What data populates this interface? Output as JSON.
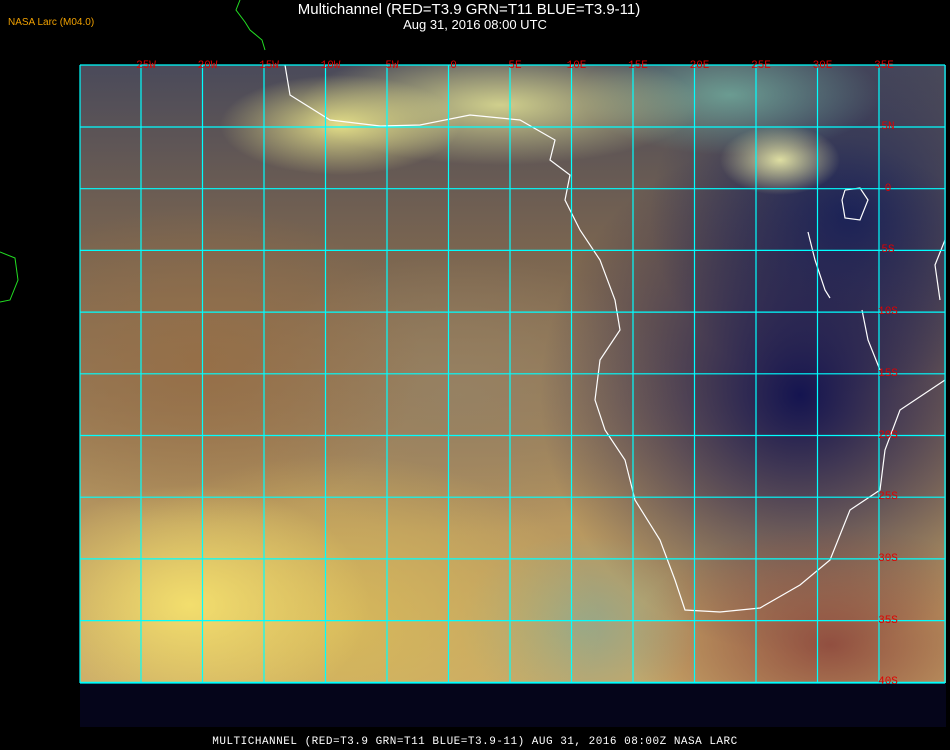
{
  "header": {
    "title": "Multichannel (RED=T3.9 GRN=T11 BLUE=T3.9-11)",
    "subtitle": "Aug 31, 2016 08:00 UTC",
    "org_label": "NASA Larc (M04.0)"
  },
  "map": {
    "lon_labels": [
      "25W",
      "20W",
      "15W",
      "10W",
      "5W",
      "0",
      "5E",
      "10E",
      "15E",
      "20E",
      "25E",
      "30E",
      "35E"
    ],
    "lat_labels": [
      "5N",
      "0",
      "5S",
      "10S",
      "15S",
      "20S",
      "25S",
      "30S",
      "35S",
      "40S"
    ],
    "grid_color": "#00ffff",
    "label_color": "#e00000",
    "coast_color": "#ffffff"
  },
  "footer": {
    "text": "MULTICHANNEL (RED=T3.9 GRN=T11 BLUE=T3.9-11) AUG 31, 2016 08:00Z   NASA LARC"
  }
}
